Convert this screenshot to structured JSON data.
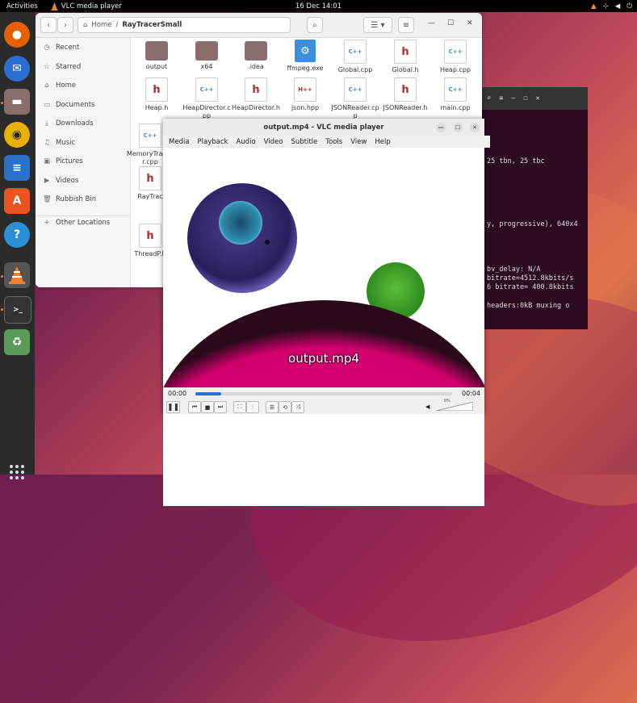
{
  "topbar": {
    "activities": "Activities",
    "app_name": "VLC media player",
    "clock": "16 Dec  14:01"
  },
  "dock": {
    "items": [
      {
        "name": "firefox-icon"
      },
      {
        "name": "thunderbird-icon"
      },
      {
        "name": "files-icon"
      },
      {
        "name": "rhythmbox-icon"
      },
      {
        "name": "writer-icon"
      },
      {
        "name": "software-center-icon"
      },
      {
        "name": "help-icon"
      },
      {
        "name": "vlc-icon"
      },
      {
        "name": "terminal-icon"
      },
      {
        "name": "trash-icon"
      }
    ]
  },
  "files": {
    "breadcrumb_home": "Home",
    "breadcrumb_folder": "RayTracerSmall",
    "sidebar": [
      {
        "icon": "clock-icon",
        "label": "Recent"
      },
      {
        "icon": "star-icon",
        "label": "Starred"
      },
      {
        "icon": "home-icon",
        "label": "Home"
      },
      {
        "icon": "document-icon",
        "label": "Documents"
      },
      {
        "icon": "download-icon",
        "label": "Downloads"
      },
      {
        "icon": "music-icon",
        "label": "Music"
      },
      {
        "icon": "picture-icon",
        "label": "Pictures"
      },
      {
        "icon": "video-icon",
        "label": "Videos"
      },
      {
        "icon": "trash-icon",
        "label": "Rubbish Bin"
      },
      {
        "icon": "plus-icon",
        "label": "Other Locations"
      }
    ],
    "grid": [
      {
        "label": "output",
        "type": "folder"
      },
      {
        "label": "x64",
        "type": "folder"
      },
      {
        "label": ".idea",
        "type": "folder"
      },
      {
        "label": "ffmpeg.exe",
        "type": "exe"
      },
      {
        "label": "Global.cpp",
        "type": "cpp"
      },
      {
        "label": "Global.h",
        "type": "h"
      },
      {
        "label": "Heap.cpp",
        "type": "cpp"
      },
      {
        "label": "Heap.h",
        "type": "h"
      },
      {
        "label": "HeapDirector.cpp",
        "type": "cpp"
      },
      {
        "label": "HeapDirector.h",
        "type": "h"
      },
      {
        "label": "json.hpp",
        "type": "hpp"
      },
      {
        "label": "JSONReader.cpp",
        "type": "cpp"
      },
      {
        "label": "JSONReader.h",
        "type": "h"
      },
      {
        "label": "main.cpp",
        "type": "cpp"
      },
      {
        "label": "MemoryTracker.cpp",
        "type": "cpp"
      },
      {
        "label": "RayTrac",
        "type": "h"
      },
      {
        "label": "ThreadP.h",
        "type": "h"
      }
    ]
  },
  "terminal": {
    "lines": [
      "25 tbn, 25 tbc",
      "y, progressive), 640x4",
      "bv_delay: N/A",
      " bitrate=4512.8kbits/s",
      "6 bitrate= 400.8kbits",
      " headers:0kB muxing o"
    ]
  },
  "vlc": {
    "title": "output.mp4 - VLC media player",
    "menu": [
      "Media",
      "Playback",
      "Audio",
      "Video",
      "Subtitle",
      "Tools",
      "View",
      "Help"
    ],
    "osd_text": "output.mp4",
    "time_elapsed": "00:00",
    "time_total": "00:04",
    "progress_fraction": 0.1,
    "volume_label": "0%"
  },
  "colors": {
    "accent": "#2b6fd4",
    "sphere_magenta": "#e5007e",
    "sphere_purple": "#3b2a78",
    "sphere_green": "#3fae2a"
  }
}
